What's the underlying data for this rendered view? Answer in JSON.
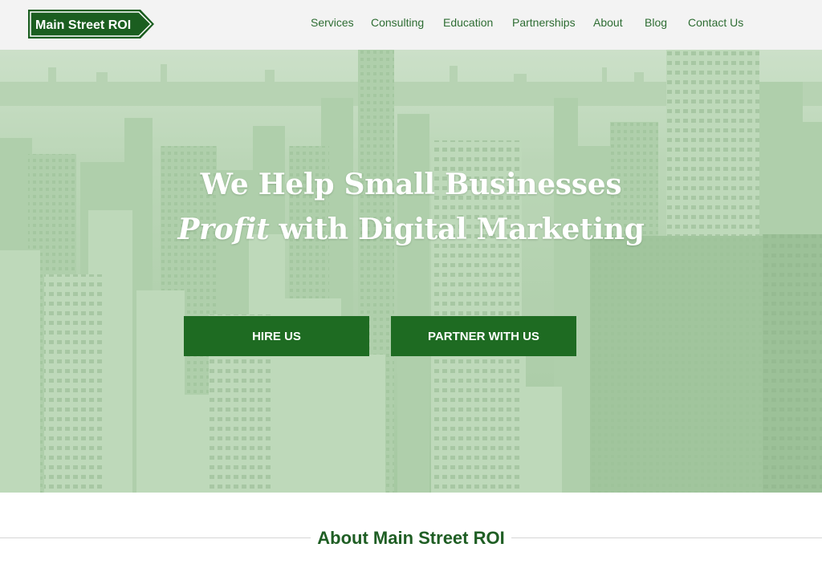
{
  "logo": {
    "text": "Main Street ROI",
    "icon": "arrow-sign-logo",
    "color": "#1b5e20"
  },
  "nav": {
    "items": [
      {
        "label": "Services"
      },
      {
        "label": "Consulting"
      },
      {
        "label": "Education"
      },
      {
        "label": "Partnerships"
      },
      {
        "label": "About"
      },
      {
        "label": "Blog"
      },
      {
        "label": "Contact Us"
      }
    ]
  },
  "hero": {
    "line1": "We Help Small Businesses",
    "line2_emphasis": "Profit",
    "line2_rest": " with Digital Marketing",
    "overlay_color": "#a9cba5",
    "background_image": "city-skyline-aerial"
  },
  "buttons": {
    "hire": "HIRE US",
    "partner": "PARTNER WITH US",
    "color": "#1e6b22"
  },
  "about": {
    "heading": "About Main Street ROI"
  }
}
